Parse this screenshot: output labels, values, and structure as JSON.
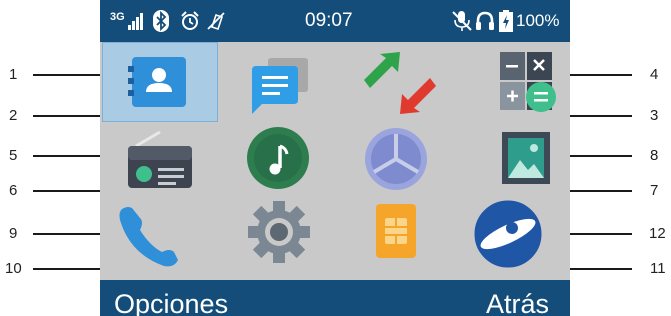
{
  "statusbar": {
    "network": "3G",
    "time": "09:07",
    "battery": "100%",
    "icons": [
      "signal-icon",
      "bluetooth-icon",
      "alarm-icon",
      "vibrate-icon",
      "mute-mic-icon",
      "headset-icon",
      "battery-icon"
    ]
  },
  "softkeys": {
    "left": "Opciones",
    "right": "Atrás"
  },
  "callouts": [
    "1",
    "2",
    "3",
    "4",
    "5",
    "6",
    "7",
    "8",
    "9",
    "10",
    "11",
    "12"
  ],
  "apps": [
    {
      "icon": "contacts-icon",
      "selected": true
    },
    {
      "icon": "messages-icon"
    },
    {
      "icon": "transfer-icon"
    },
    {
      "icon": "calculator-icon"
    },
    {
      "icon": "radio-icon"
    },
    {
      "icon": "music-icon"
    },
    {
      "icon": "clock-icon"
    },
    {
      "icon": "gallery-icon"
    },
    {
      "icon": "phone-icon"
    },
    {
      "icon": "settings-icon"
    },
    {
      "icon": "sim-toolkit-icon"
    },
    {
      "icon": "browser-icon"
    }
  ],
  "colors": {
    "bar": "#144d79",
    "screen": "#c9c9c9",
    "selection": "#a9cce4",
    "accent": "#2f8fd8"
  }
}
